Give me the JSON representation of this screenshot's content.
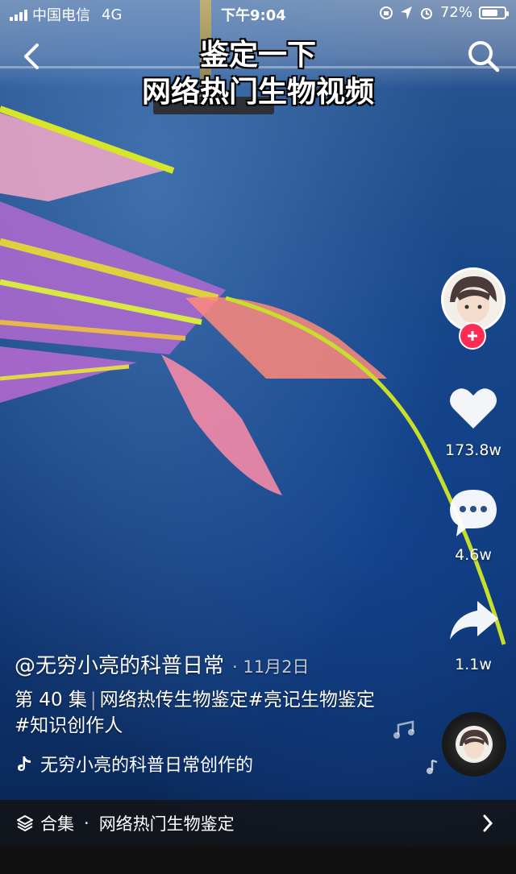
{
  "status_bar": {
    "carrier": "中国电信",
    "network": "4G",
    "time": "下午9:04",
    "battery": "72%",
    "battery_level": 0.72
  },
  "video": {
    "overlay_title_line1": "鉴定一下",
    "overlay_title_line2": "网络热门生物视频"
  },
  "actions": {
    "likes": "173.8w",
    "comments": "4.6w",
    "shares": "1.1w"
  },
  "post": {
    "author": "@无穷小亮的科普日常",
    "date": "· 11月2日",
    "episode": "第 40 集",
    "separator": "|",
    "description": "网络热传生物鉴定#亮记生物鉴定 #知识创作人",
    "music": "无穷小亮的科普日常创作的"
  },
  "collection": {
    "label": "合集",
    "dot": "·",
    "name": "网络热门生物鉴定"
  },
  "colors": {
    "follow_red": "#fe2c55",
    "fish_yellow": "#d8e62a",
    "fish_pink": "#f07aa0"
  }
}
